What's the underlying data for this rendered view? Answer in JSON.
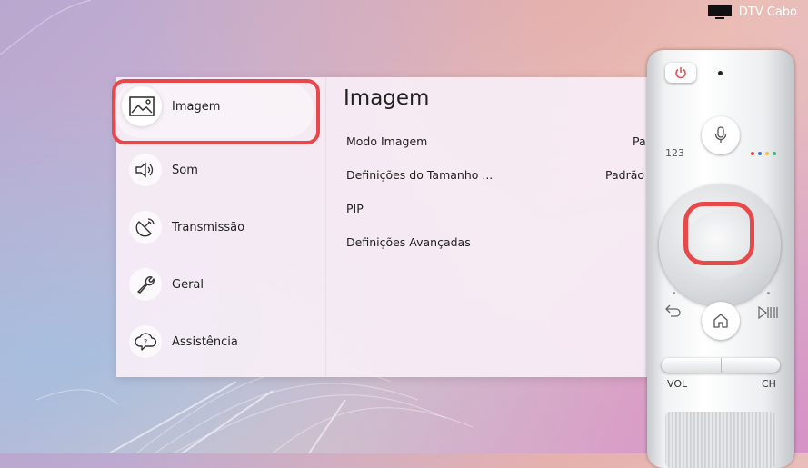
{
  "source": {
    "icon": "tv-icon",
    "label": "DTV Cabo"
  },
  "sidebar": {
    "items": [
      {
        "label": "Imagem",
        "icon": "picture-icon",
        "selected": true
      },
      {
        "label": "Som",
        "icon": "speaker-icon"
      },
      {
        "label": "Transmissão",
        "icon": "satellite-dish-icon"
      },
      {
        "label": "Geral",
        "icon": "wrench-icon"
      },
      {
        "label": "Assistência",
        "icon": "help-cloud-icon"
      }
    ]
  },
  "content": {
    "title": "Imagem",
    "rows": [
      {
        "label": "Modo Imagem",
        "value": "Pa"
      },
      {
        "label": "Definições do Tamanho ...",
        "value": "Padrão"
      },
      {
        "label": "PIP",
        "value": ""
      },
      {
        "label": "Definições Avançadas",
        "value": ""
      }
    ]
  },
  "remote": {
    "numbers_label": "123",
    "vol_label": "VOL",
    "ch_label": "CH",
    "color_dots": [
      "#e8484a",
      "#3b7be0",
      "#f2c230",
      "#3db56a"
    ]
  },
  "colors": {
    "highlight": "#e8484a",
    "power": "#e8484a"
  }
}
